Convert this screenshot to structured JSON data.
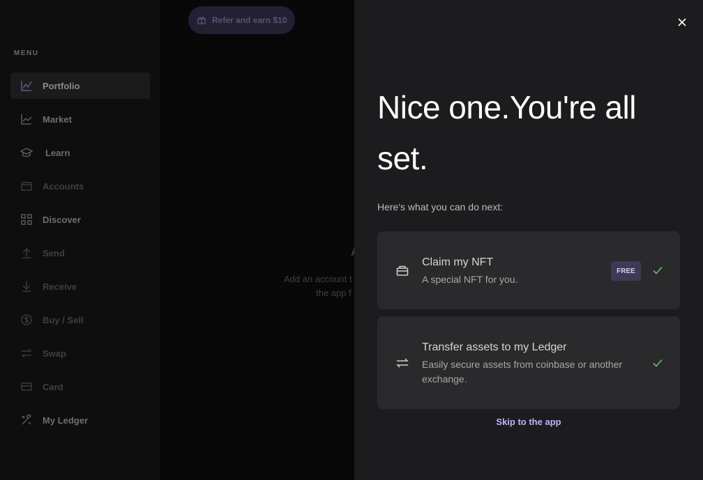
{
  "sidebar": {
    "menu_title": "MENU",
    "items": [
      {
        "label": "Portfolio"
      },
      {
        "label": "Market"
      },
      {
        "label": "Learn"
      },
      {
        "label": "Accounts"
      },
      {
        "label": "Discover"
      },
      {
        "label": "Send"
      },
      {
        "label": "Receive"
      },
      {
        "label": "Buy / Sell"
      },
      {
        "label": "Swap"
      },
      {
        "label": "Card"
      },
      {
        "label": "My Ledger"
      }
    ]
  },
  "main": {
    "refer_label": "Refer and earn $10",
    "heading_fragment": "A",
    "text_line1": "Add an account t",
    "text_line2": "the app f"
  },
  "drawer": {
    "title": "Nice one.You're all set.",
    "subtitle": "Here's what you can do next:",
    "cards": [
      {
        "title": "Claim my NFT",
        "description": "A special NFT for you.",
        "badge": "FREE",
        "icon": "gift-icon"
      },
      {
        "title": "Transfer assets to my Ledger",
        "description": "Easily secure assets from coinbase or another exchange.",
        "icon": "transfer-icon"
      }
    ],
    "skip_label": "Skip to the app"
  },
  "colors": {
    "accent": "#bfb3ff",
    "check": "#6ebf6a",
    "badge_bg": "#3d3a58"
  }
}
